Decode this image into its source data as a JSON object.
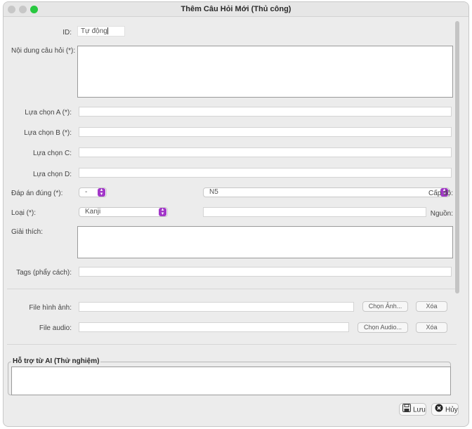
{
  "window": {
    "title": "Thêm Câu Hỏi Mới (Thủ công)"
  },
  "form": {
    "id_label": "ID:",
    "id_value": "Tự động",
    "content_label": "Nội dung câu hỏi (*):",
    "choice_a_label": "Lựa chọn A (*):",
    "choice_b_label": "Lựa chọn B (*):",
    "choice_c_label": "Lựa chọn C:",
    "choice_d_label": "Lựa chọn D:",
    "answer_label": "Đáp án đúng (*):",
    "answer_value": "-",
    "level_value": "N5",
    "level_label": "Cấp độ:",
    "type_label": "Loại (*):",
    "type_value": "Kanji",
    "source_label": "Nguồn:",
    "explanation_label": "Giải thích:",
    "tags_label": "Tags (phẩy cách):",
    "image_label": "File hình ảnh:",
    "choose_image_button": "Chọn Ảnh...",
    "delete_image_button": "Xóa",
    "audio_label": "File audio:",
    "choose_audio_button": "Chọn Audio...",
    "delete_audio_button": "Xóa"
  },
  "ai_section": {
    "title": "Hỗ trợ từ AI (Thử nghiệm)"
  },
  "footer": {
    "save_label": "Lưu",
    "cancel_label": "Hủy"
  },
  "colors": {
    "accent": "#a237c8",
    "traffic_green": "#28c840"
  },
  "icons": [
    "save-icon",
    "cancel-icon",
    "chevron-updown-icon"
  ]
}
